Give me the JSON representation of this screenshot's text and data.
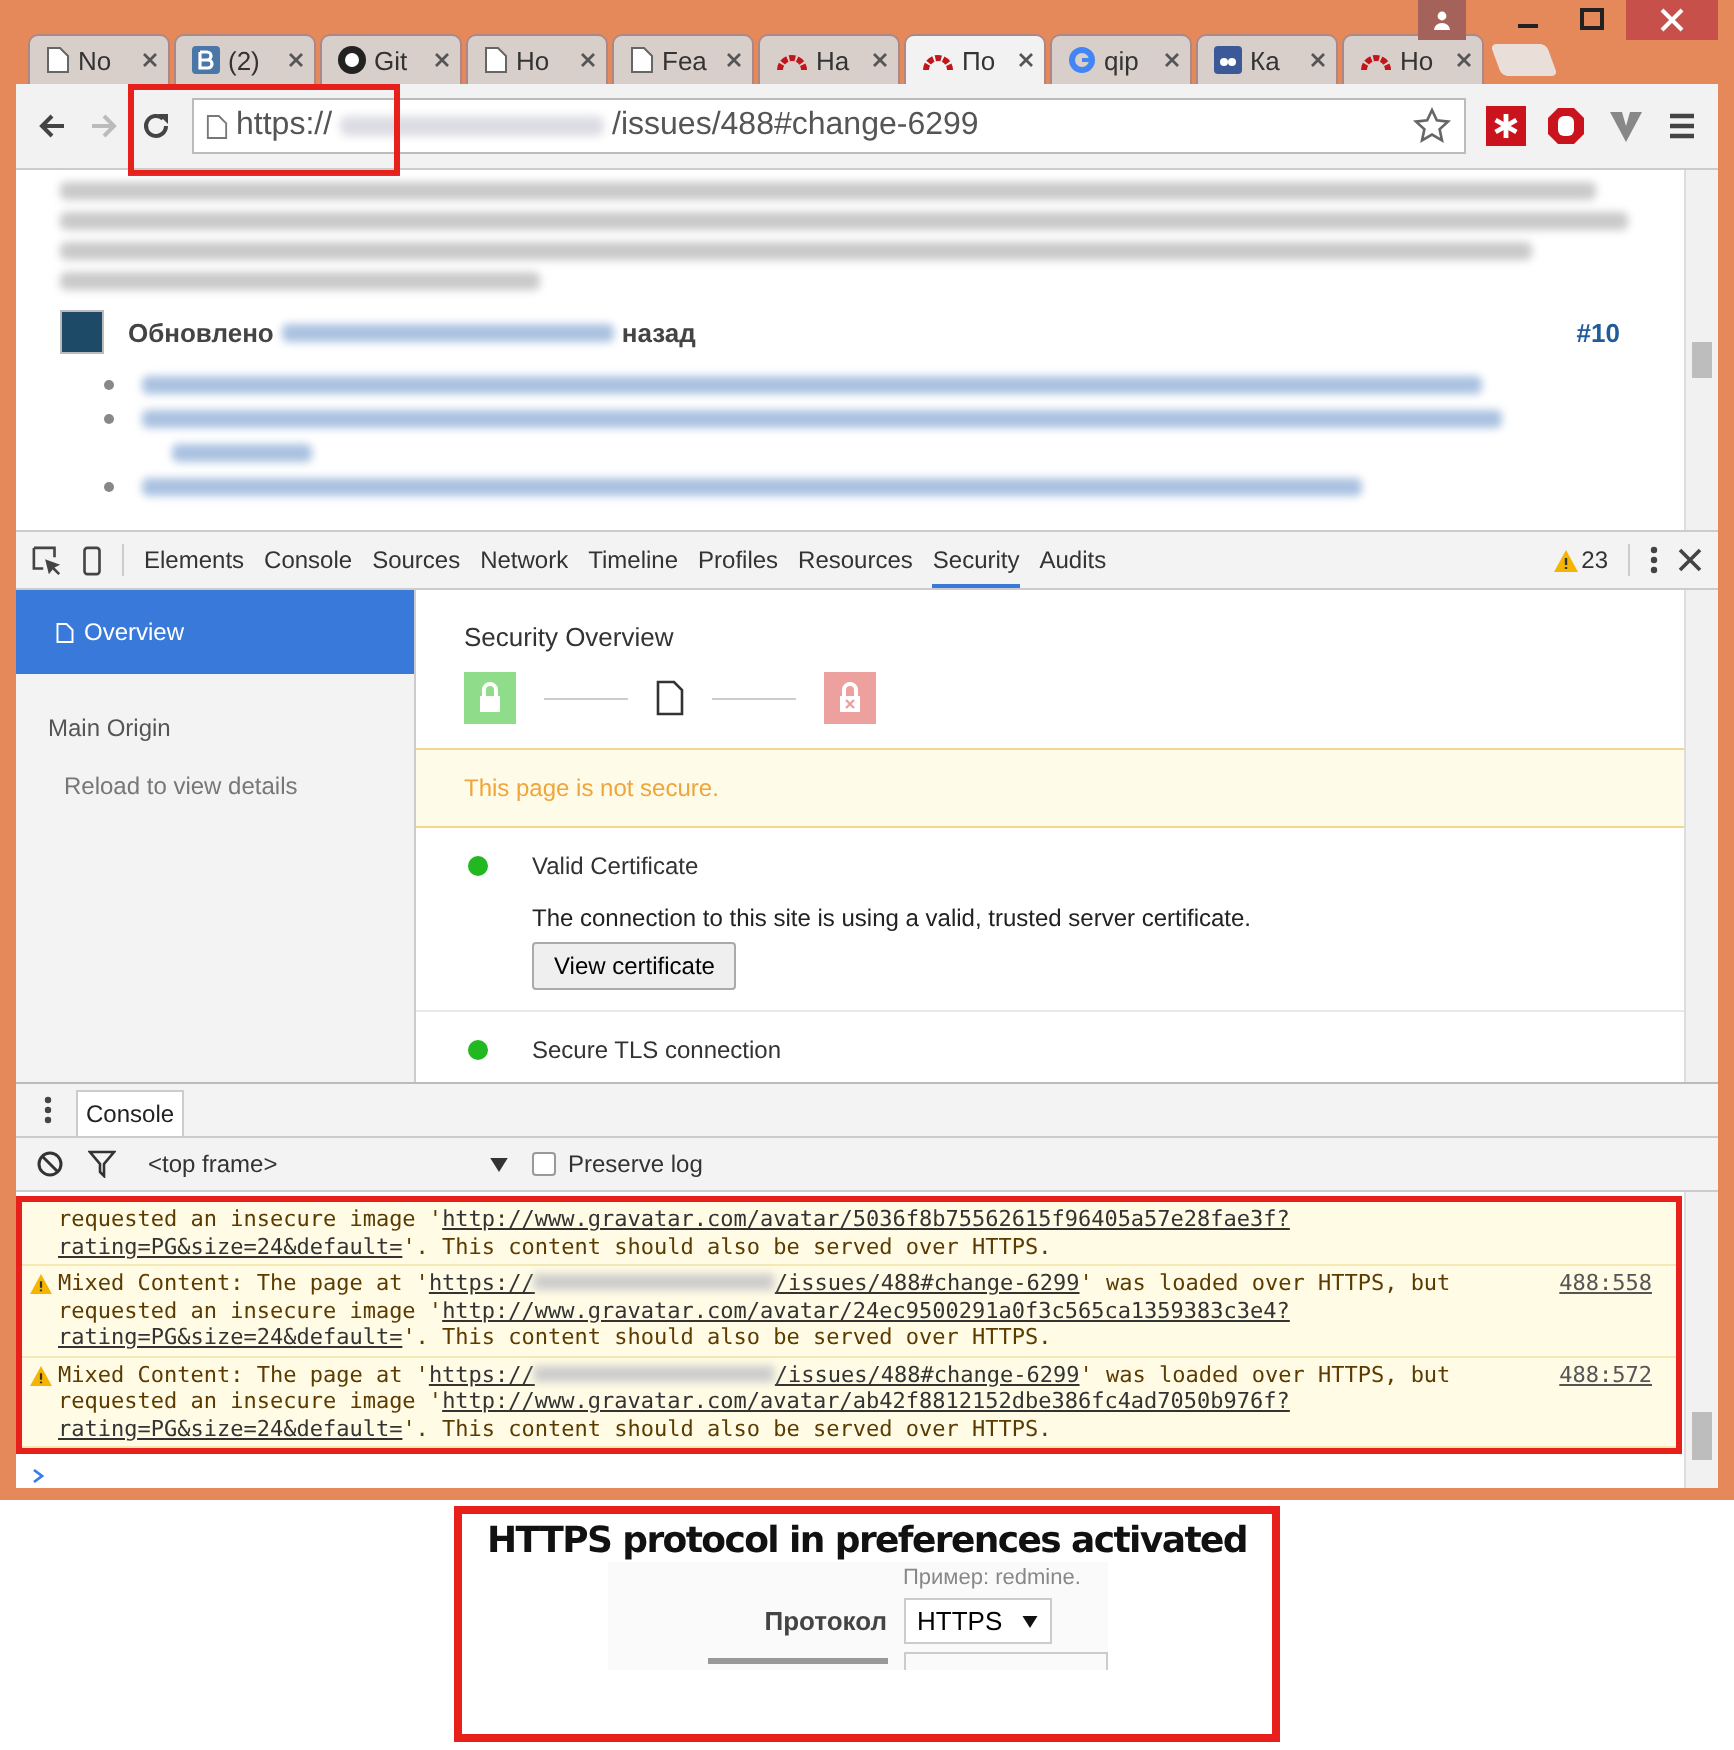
{
  "browser_tabs": [
    {
      "label": "No",
      "kind": "page",
      "selected": false
    },
    {
      "label": "(2)",
      "kind": "vk",
      "selected": false
    },
    {
      "label": "Git",
      "kind": "github",
      "selected": false
    },
    {
      "label": "Ho",
      "kind": "page",
      "selected": false
    },
    {
      "label": "Fea",
      "kind": "page",
      "selected": false
    },
    {
      "label": "На",
      "kind": "redmine",
      "selected": false
    },
    {
      "label": "По",
      "kind": "redmine",
      "selected": true
    },
    {
      "label": "qip",
      "kind": "google",
      "selected": false
    },
    {
      "label": "Ка",
      "kind": "badge",
      "selected": false
    },
    {
      "label": "Но",
      "kind": "redmine",
      "selected": false
    }
  ],
  "address_bar": {
    "scheme": "https://",
    "path": "/issues/488#change-6299"
  },
  "page": {
    "updated_label": "Обновлено",
    "ago": "назад",
    "entry_number": "#10"
  },
  "devtools": {
    "tabs": [
      {
        "label": "Elements",
        "selected": false
      },
      {
        "label": "Console",
        "selected": false
      },
      {
        "label": "Sources",
        "selected": false
      },
      {
        "label": "Network",
        "selected": false
      },
      {
        "label": "Timeline",
        "selected": false
      },
      {
        "label": "Profiles",
        "selected": false
      },
      {
        "label": "Resources",
        "selected": false
      },
      {
        "label": "Security",
        "selected": true
      },
      {
        "label": "Audits",
        "selected": false
      }
    ],
    "warning_count": "23",
    "sidebar": [
      {
        "label": "Overview",
        "kind": "item",
        "selected": true
      },
      {
        "label": "Main Origin",
        "kind": "heading",
        "selected": false
      },
      {
        "label": "Reload to view details",
        "kind": "note",
        "selected": false
      }
    ],
    "security": {
      "title": "Security Overview",
      "banner": "This page is not secure.",
      "checks": [
        {
          "title": "Valid Certificate",
          "description": "The connection to this site is using a valid, trusted server certificate.",
          "button": "View certificate",
          "color": "#22b822"
        },
        {
          "title": "Secure TLS connection",
          "color": "#22b822"
        }
      ]
    },
    "console": {
      "tab": "Console",
      "context": "<top frame>",
      "preserve_log": {
        "label": "Preserve log",
        "checked": false
      },
      "messages": [
        {
          "kind": "continuation",
          "lines": [
            [
              {
                "kind": "text",
                "text": "requested an insecure image '"
              },
              {
                "kind": "link",
                "text": "http://www.gravatar.com/avatar/5036f8b75562615f96405a57e28fae3f?"
              }
            ],
            [
              {
                "kind": "link",
                "text": "rating=PG&size=24&default="
              },
              {
                "kind": "text",
                "text": "'. This content should also be served over HTTPS."
              }
            ]
          ]
        },
        {
          "kind": "warning",
          "source": "488:558",
          "lines": [
            [
              {
                "kind": "text",
                "text": "Mixed Content: The page at '"
              },
              {
                "kind": "link",
                "text": "https://"
              },
              {
                "kind": "blurred"
              },
              {
                "kind": "link",
                "text": "/issues/488#change-6299"
              },
              {
                "kind": "text",
                "text": "' was loaded over HTTPS, but"
              }
            ],
            [
              {
                "kind": "text",
                "text": "requested an insecure image '"
              },
              {
                "kind": "link",
                "text": "http://www.gravatar.com/avatar/24ec9500291a0f3c565ca1359383c3e4?"
              }
            ],
            [
              {
                "kind": "link",
                "text": "rating=PG&size=24&default="
              },
              {
                "kind": "text",
                "text": "'. This content should also be served over HTTPS."
              }
            ]
          ]
        },
        {
          "kind": "warning",
          "source": "488:572",
          "lines": [
            [
              {
                "kind": "text",
                "text": "Mixed Content: The page at '"
              },
              {
                "kind": "link",
                "text": "https://"
              },
              {
                "kind": "blurred"
              },
              {
                "kind": "link",
                "text": "/issues/488#change-6299"
              },
              {
                "kind": "text",
                "text": "' was loaded over HTTPS, but"
              }
            ],
            [
              {
                "kind": "text",
                "text": "requested an insecure image '"
              },
              {
                "kind": "link",
                "text": "http://www.gravatar.com/avatar/ab42f8812152dbe386fc4ad7050b976f?"
              }
            ],
            [
              {
                "kind": "link",
                "text": "rating=PG&size=24&default="
              },
              {
                "kind": "text",
                "text": "'. This content should also be served over HTTPS."
              }
            ]
          ]
        }
      ]
    }
  },
  "annotation": {
    "caption": "HTTPS protocol in preferences activated",
    "example": "Пример: redmine.",
    "field_label": "Протокол",
    "field_value": "HTTPS"
  }
}
